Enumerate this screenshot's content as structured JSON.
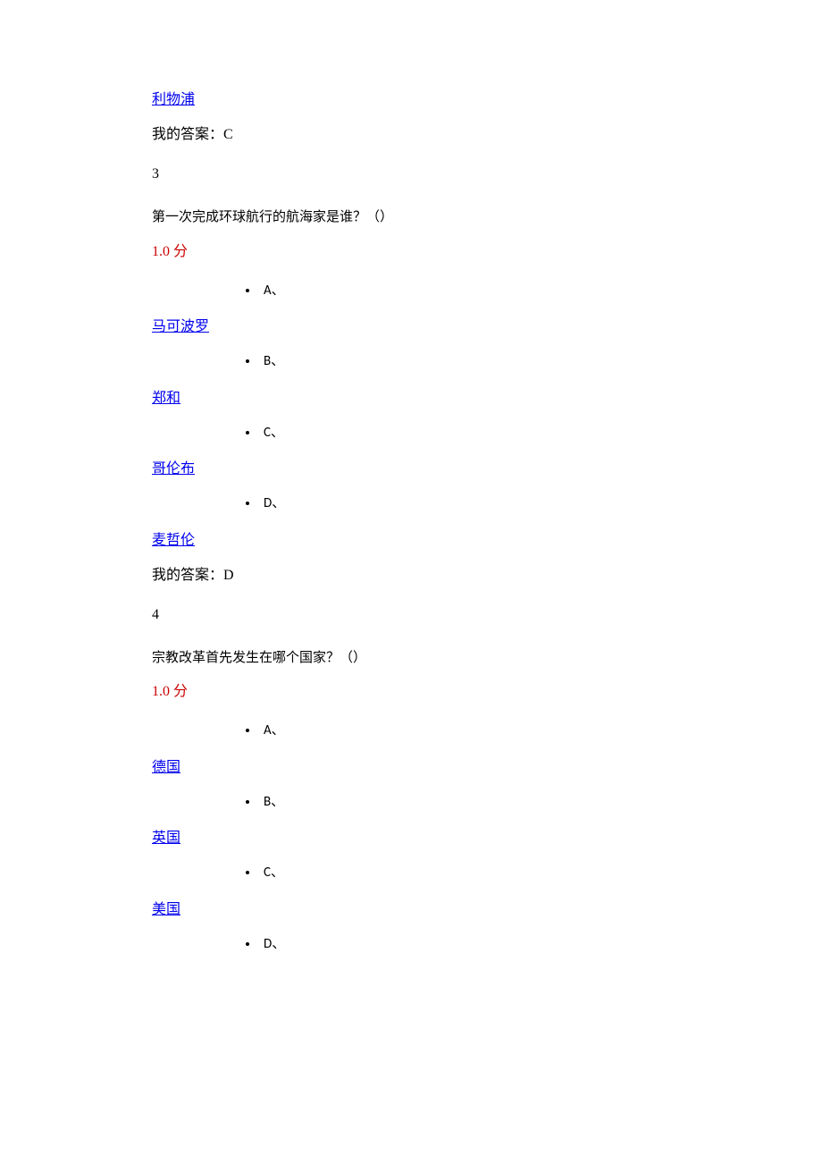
{
  "leading": {
    "option_d": "利物浦",
    "my_answer_label": "我的答案：C"
  },
  "q3": {
    "number": "3",
    "text": "第一次完成环球航行的航海家是谁？（）",
    "score": "1.0  分",
    "options": {
      "a_label": "A、",
      "a_text": "马可波罗",
      "b_label": "B、",
      "b_text": "郑和",
      "c_label": "C、",
      "c_text": "哥伦布",
      "d_label": "D、",
      "d_text": "麦哲伦"
    },
    "my_answer_label": "我的答案：D"
  },
  "q4": {
    "number": "4",
    "text": "宗教改革首先发生在哪个国家？（）",
    "score": "1.0  分",
    "options": {
      "a_label": "A、",
      "a_text": "德国",
      "b_label": "B、",
      "b_text": "英国",
      "c_label": "C、",
      "c_text": "美国",
      "d_label": "D、"
    }
  }
}
